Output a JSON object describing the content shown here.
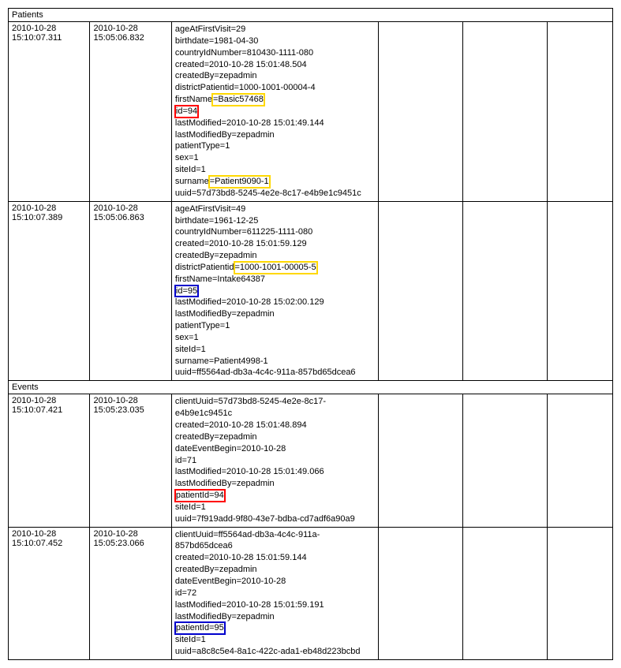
{
  "sections": {
    "patients": {
      "header": "Patients"
    },
    "events": {
      "header": "Events"
    }
  },
  "rows": [
    {
      "ts1": "2010-10-28 15:10:07.311",
      "ts2": "2010-10-28 15:05:06.832",
      "d": [
        {
          "t": "ageAtFirstVisit=29"
        },
        {
          "t": "birthdate=1981-04-30"
        },
        {
          "t": "countryIdNumber=810430-1111-080"
        },
        {
          "t": "created=2010-10-28 15:01:48.504"
        },
        {
          "t": "createdBy=zepadmin"
        },
        {
          "t": "districtPatientid=1000-1001-00004-4"
        },
        {
          "pre": "firstName",
          "hl": "yellow",
          "mid": "=Basic57468"
        },
        {
          "hl": "red",
          "mid": "id=94"
        },
        {
          "t": "lastModified=2010-10-28 15:01:49.144"
        },
        {
          "t": "lastModifiedBy=zepadmin"
        },
        {
          "t": "patientType=1"
        },
        {
          "t": "sex=1"
        },
        {
          "t": "siteId=1"
        },
        {
          "pre": "surname",
          "hl": "yellow",
          "mid": "=Patient9090-1"
        },
        {
          "t": "uuid=57d73bd8-5245-4e2e-8c17-e4b9e1c9451c"
        }
      ]
    },
    {
      "ts1": "2010-10-28 15:10:07.389",
      "ts2": "2010-10-28 15:05:06.863",
      "d": [
        {
          "t": "ageAtFirstVisit=49"
        },
        {
          "t": "birthdate=1961-12-25"
        },
        {
          "t": "countryIdNumber=611225-1111-080"
        },
        {
          "t": "created=2010-10-28 15:01:59.129"
        },
        {
          "t": "createdBy=zepadmin"
        },
        {
          "pre": "districtPatientid",
          "hl": "yellow",
          "mid": "=1000-1001-00005-5"
        },
        {
          "t": "firstName=Intake64387"
        },
        {
          "hl": "blue",
          "mid": "id=95"
        },
        {
          "t": "lastModified=2010-10-28 15:02:00.129"
        },
        {
          "t": "lastModifiedBy=zepadmin"
        },
        {
          "t": "patientType=1"
        },
        {
          "t": "sex=1"
        },
        {
          "t": "siteId=1"
        },
        {
          "t": "surname=Patient4998-1"
        },
        {
          "t": "uuid=ff5564ad-db3a-4c4c-911a-857bd65dcea6"
        }
      ]
    },
    {
      "ts1": "2010-10-28 15:10:07.421",
      "ts2": "2010-10-28 15:05:23.035",
      "d": [
        {
          "t": "clientUuid=57d73bd8-5245-4e2e-8c17-e4b9e1c9451c"
        },
        {
          "t": "created=2010-10-28 15:01:48.894"
        },
        {
          "t": "createdBy=zepadmin"
        },
        {
          "t": "dateEventBegin=2010-10-28"
        },
        {
          "t": "id=71"
        },
        {
          "t": "lastModified=2010-10-28 15:01:49.066"
        },
        {
          "t": "lastModifiedBy=zepadmin"
        },
        {
          "hl": "red",
          "mid": "patientId=94"
        },
        {
          "t": "siteId=1"
        },
        {
          "t": "uuid=7f919add-9f80-43e7-bdba-cd7adf6a90a9"
        }
      ]
    },
    {
      "ts1": "2010-10-28 15:10:07.452",
      "ts2": "2010-10-28 15:05:23.066",
      "d": [
        {
          "t": "clientUuid=ff5564ad-db3a-4c4c-911a-857bd65dcea6"
        },
        {
          "t": "created=2010-10-28 15:01:59.144"
        },
        {
          "t": "createdBy=zepadmin"
        },
        {
          "t": "dateEventBegin=2010-10-28"
        },
        {
          "t": "id=72"
        },
        {
          "t": "lastModified=2010-10-28 15:01:59.191"
        },
        {
          "t": "lastModifiedBy=zepadmin"
        },
        {
          "hl": "blue",
          "mid": "patientId=95"
        },
        {
          "t": "siteId=1"
        },
        {
          "t": "uuid=a8c8c5e4-8a1c-422c-ada1-eb48d223bcbd"
        }
      ]
    }
  ]
}
